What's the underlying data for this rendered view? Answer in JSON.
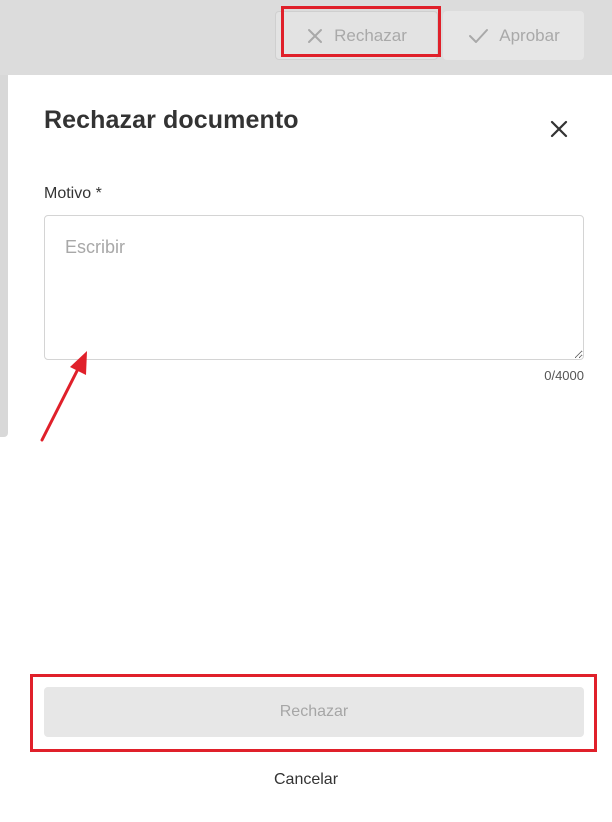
{
  "header": {
    "reject_label": "Rechazar",
    "reject_icon": "close-icon",
    "approve_label": "Aprobar",
    "approve_icon": "check-icon"
  },
  "dialog": {
    "title": "Rechazar documento",
    "close_icon": "close-icon",
    "field_label": "Motivo *",
    "input_value": "",
    "input_placeholder": "Escribir",
    "char_counter": "0/4000",
    "submit_label": "Rechazar",
    "cancel_label": "Cancelar"
  },
  "colors": {
    "annotation": "#e0202a",
    "disabled_text": "#a6a6a6",
    "disabled_bg": "#e7e7e7"
  }
}
